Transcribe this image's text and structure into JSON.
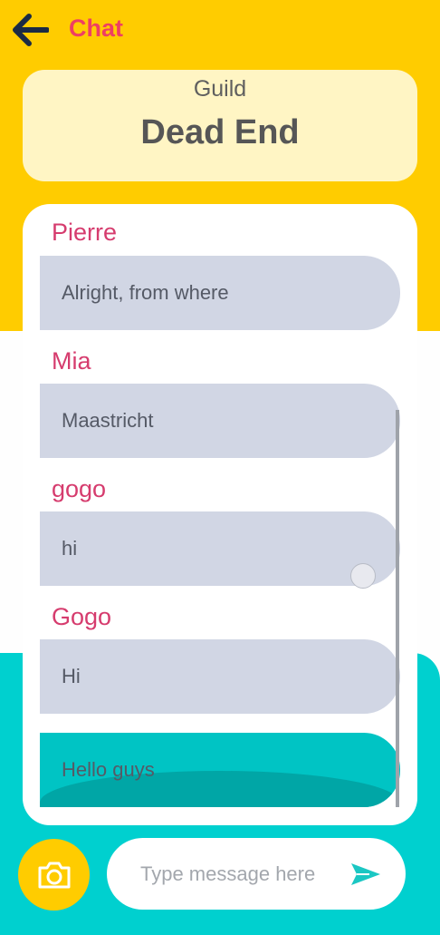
{
  "header": {
    "back_icon": "arrow-left-icon",
    "title": "Chat"
  },
  "guild": {
    "label": "Guild",
    "name": "Dead End"
  },
  "messages": [
    {
      "sender": "Pierre",
      "text": "Alright, from where"
    },
    {
      "sender": "Mia",
      "text": "Maastricht"
    },
    {
      "sender": "gogo",
      "text": "hi"
    },
    {
      "sender": "Gogo",
      "text": "Hi"
    },
    {
      "sender": "",
      "text": "Hello guys",
      "own": true
    }
  ],
  "composer": {
    "camera_icon": "camera-icon",
    "placeholder": "Type message here",
    "value": "",
    "send_icon": "send-icon"
  },
  "colors": {
    "top_background": "#ffcc00",
    "bottom_background": "#00d0cf",
    "guild_card": "#fff5c4",
    "accent_title": "#ee3f63",
    "sender_name": "#d63c6e",
    "bubble": "#d1d6e4",
    "own_bubble": "#00c4c4"
  }
}
